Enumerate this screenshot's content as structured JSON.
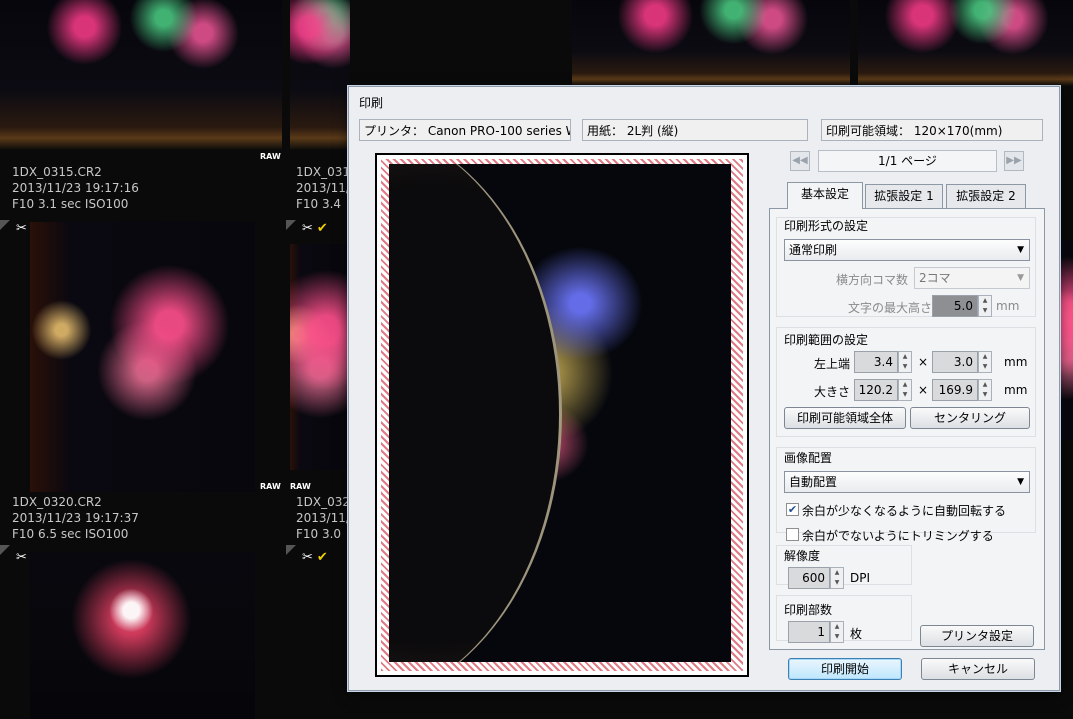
{
  "background": {
    "thumbnails": [
      {
        "filename": "1DX_0315.CR2",
        "datetime": "2013/11/23 19:17:16",
        "exposure": "F10 3.1 sec ISO100",
        "badge": "RAW"
      },
      {
        "filename": "1DX_0320.CR2",
        "datetime": "2013/11/23 19:17:37",
        "exposure": "F10 6.5 sec ISO100",
        "badge": "RAW"
      },
      {
        "filename": "1DX_031",
        "datetime": "2013/11/",
        "exposure": "F10 3.4"
      },
      {
        "filename": "1DX_032",
        "datetime": "2013/11/",
        "exposure": "F10 3.0"
      },
      {
        "badge": "RAW"
      }
    ],
    "icons": {
      "scissors": "✂",
      "check": "✔"
    }
  },
  "dialog": {
    "title": "印刷",
    "printer_info": "プリンタ： Canon PRO-100 series W",
    "paper_info": "用紙： 2L判 (縦)",
    "printable_area_info": "印刷可能領域： 120×170(mm)",
    "page_indicator": "1/1 ページ",
    "nav": {
      "prev": "◀◀",
      "next": "▶▶"
    },
    "tabs": [
      {
        "label": "基本設定",
        "active": true
      },
      {
        "label": "拡張設定 1",
        "active": false
      },
      {
        "label": "拡張設定 2",
        "active": false
      }
    ],
    "print_format": {
      "title": "印刷形式の設定",
      "selected": "通常印刷",
      "frames_label": "横方向コマ数",
      "frames_value": "2コマ",
      "max_text_height_label": "文字の最大高さ",
      "max_text_height_value": "5.0",
      "max_text_height_unit": "mm"
    },
    "print_range": {
      "title": "印刷範囲の設定",
      "top_left_label": "左上端",
      "top_left_x": "3.4",
      "top_left_y": "3.0",
      "size_label": "大きさ",
      "size_w": "120.2",
      "size_h": "169.9",
      "times": "×",
      "unit": "mm",
      "full_area_button": "印刷可能領域全体",
      "center_button": "センタリング"
    },
    "image_layout": {
      "title": "画像配置",
      "selected": "自動配置",
      "auto_rotate_label": "余白が少なくなるように自動回転する",
      "auto_rotate_checked": true,
      "trim_label": "余白がでないようにトリミングする",
      "trim_checked": false
    },
    "resolution": {
      "title": "解像度",
      "value": "600",
      "unit": "DPI"
    },
    "copies": {
      "title": "印刷部数",
      "value": "1",
      "unit": "枚"
    },
    "printer_settings_button": "プリンタ設定",
    "start_button": "印刷開始",
    "cancel_button": "キャンセル"
  }
}
